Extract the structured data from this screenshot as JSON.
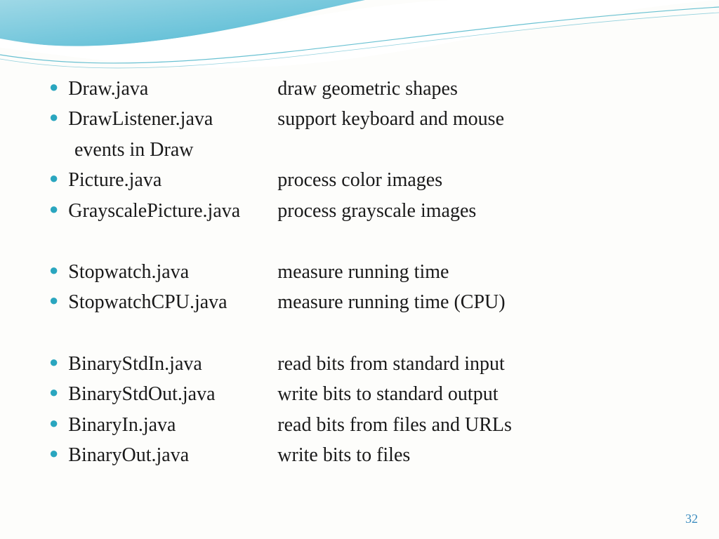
{
  "page_number": "32",
  "colors": {
    "bullet": "#2aa6bf",
    "text": "#1a1a1a",
    "pagenum": "#3a8bbf"
  },
  "groups": [
    {
      "items": [
        {
          "label": "Draw.java",
          "desc": "draw geometric shapes"
        },
        {
          "label": "DrawListener.java",
          "desc": "support keyboard and mouse",
          "wrap": "events in Draw"
        },
        {
          "label": "Picture.java",
          "desc": "process color images"
        },
        {
          "label": "GrayscalePicture.java",
          "desc": "process grayscale images"
        }
      ]
    },
    {
      "items": [
        {
          "label": "Stopwatch.java",
          "desc": "measure running time"
        },
        {
          "label": "StopwatchCPU.java",
          "desc": "measure running time (CPU)"
        }
      ]
    },
    {
      "items": [
        {
          "label": "BinaryStdIn.java",
          "desc": "read bits from standard input"
        },
        {
          "label": "BinaryStdOut.java",
          "desc": "write bits to standard output"
        },
        {
          "label": "BinaryIn.java",
          "desc": "read bits from files and URLs"
        },
        {
          "label": "BinaryOut.java",
          "desc": "write bits to files"
        }
      ]
    }
  ]
}
